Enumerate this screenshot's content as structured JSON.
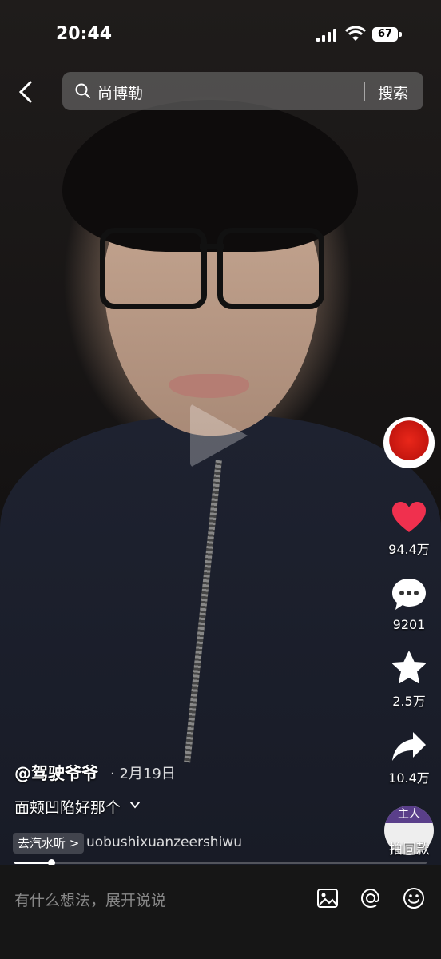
{
  "status": {
    "time": "20:44",
    "battery": "67"
  },
  "search": {
    "query": "尚博勒",
    "button_label": "搜索"
  },
  "rail": {
    "like_count": "94.4万",
    "comment_count": "9201",
    "favorite_count": "2.5万",
    "share_count": "10.4万",
    "music_tag": "主人",
    "music_caption": "拍同款"
  },
  "post": {
    "author": "@驾驶爷爷",
    "date": "· 2月19日",
    "description": "面颊凹陷好那个",
    "listen_label": "去汽水听 >",
    "music_title": "uobushixuanzeershiwu"
  },
  "progress": {
    "fraction": 0.09
  },
  "comment": {
    "placeholder": "有什么想法，展开说说"
  },
  "colors": {
    "like": "#f0304e"
  },
  "icons": [
    "back-icon",
    "search-icon",
    "heart-icon",
    "comment-icon",
    "star-icon",
    "share-icon",
    "image-icon",
    "at-icon",
    "emoji-icon",
    "play-icon"
  ]
}
